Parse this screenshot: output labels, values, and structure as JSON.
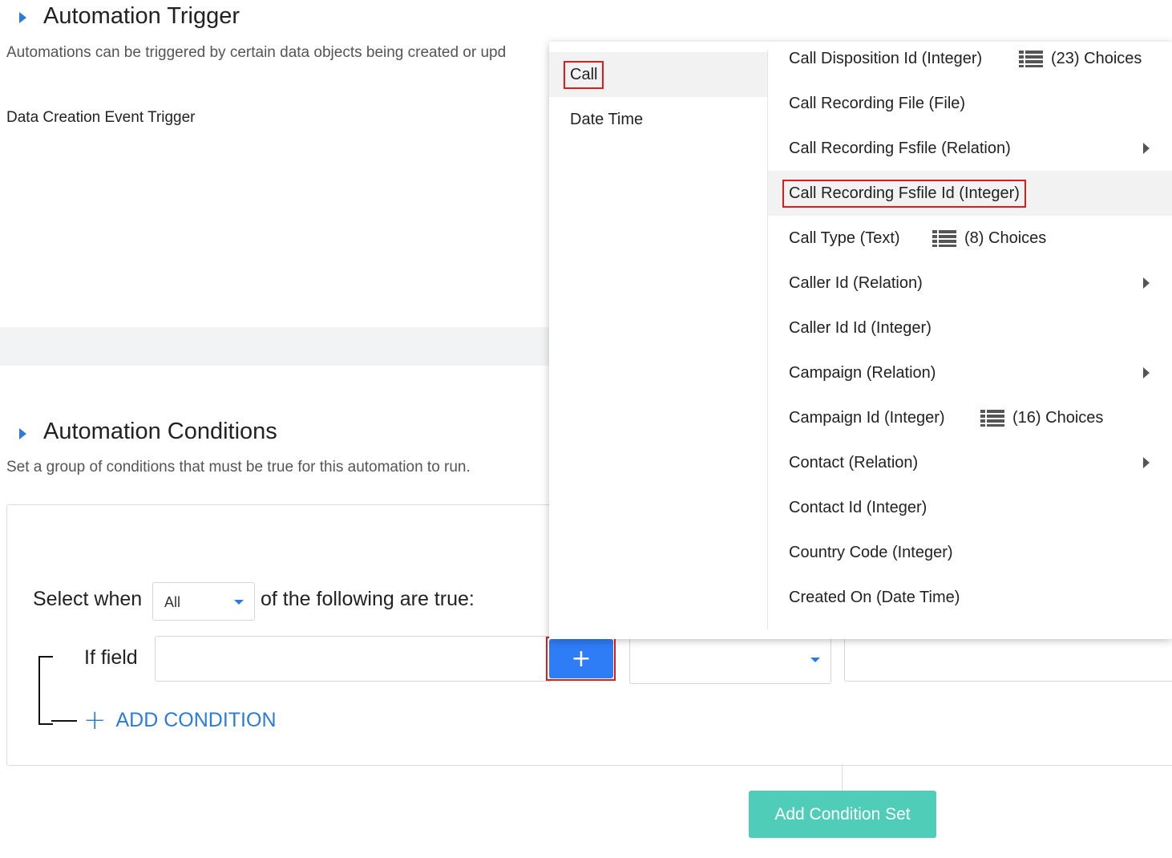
{
  "trigger": {
    "title": "Automation Trigger",
    "description": "Automations can be triggered by certain data objects being created or upd",
    "event_label": "Data Creation Event Trigger"
  },
  "conditions": {
    "title": "Automation Conditions",
    "description": "Set a group of conditions that must be true for this automation to run.",
    "select_when_label": "Select when",
    "match_select_value": "All",
    "following_label": "of the following are true:",
    "if_field_label": "If field",
    "field_input_value": "",
    "field_add_button": "+",
    "add_condition_label": "ADD CONDITION",
    "add_condition_icon": "+",
    "add_condition_set_label": "Add Condition Set"
  },
  "dropdown": {
    "categories": [
      {
        "label": "Call",
        "active": true,
        "highlighted": true
      },
      {
        "label": "Date Time",
        "active": false,
        "highlighted": false
      }
    ],
    "fields": [
      {
        "label": "Call Disposition Id (Integer)",
        "choices": "(23) Choices",
        "submenu": false
      },
      {
        "label": "Call Recording File (File)",
        "choices": "",
        "submenu": false
      },
      {
        "label": "Call Recording Fsfile (Relation)",
        "choices": "",
        "submenu": true
      },
      {
        "label": "Call Recording Fsfile Id (Integer)",
        "choices": "",
        "submenu": false,
        "highlighted": true
      },
      {
        "label": "Call Type (Text)",
        "choices": "(8) Choices",
        "submenu": false
      },
      {
        "label": "Caller Id (Relation)",
        "choices": "",
        "submenu": true
      },
      {
        "label": "Caller Id Id (Integer)",
        "choices": "",
        "submenu": false
      },
      {
        "label": "Campaign (Relation)",
        "choices": "",
        "submenu": true
      },
      {
        "label": "Campaign Id (Integer)",
        "choices": "(16) Choices",
        "submenu": false
      },
      {
        "label": "Contact (Relation)",
        "choices": "",
        "submenu": true
      },
      {
        "label": "Contact Id (Integer)",
        "choices": "",
        "submenu": false
      },
      {
        "label": "Country Code (Integer)",
        "choices": "",
        "submenu": false
      },
      {
        "label": "Created On (Date Time)",
        "choices": "",
        "submenu": false
      }
    ]
  },
  "icons": {
    "section_caret": "caret-right-icon",
    "select_caret": "chevron-down-icon",
    "choices_icon": "list-icon",
    "submenu_arrow": "caret-right-icon"
  },
  "colors": {
    "accent": "#2b7bd8",
    "primary_button": "#2e7cf6",
    "teal_button": "#4fcdb9",
    "highlight_outline": "#e01b1b"
  }
}
